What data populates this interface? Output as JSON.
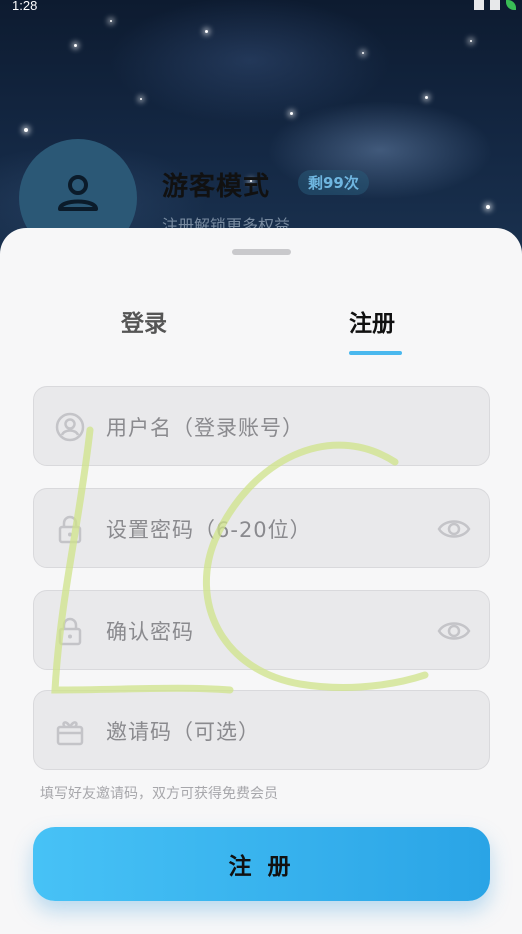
{
  "status_bar": {
    "time": "1:28"
  },
  "profile": {
    "title": "游客模式",
    "badge": "剩99次",
    "subtitle": "注册解锁更多权益"
  },
  "tabs": [
    {
      "label": "登录",
      "active": false
    },
    {
      "label": "注册",
      "active": true
    }
  ],
  "form": {
    "username_placeholder": "用户名（登录账号）",
    "password_placeholder": "设置密码（6-20位）",
    "confirm_placeholder": "确认密码",
    "invite_placeholder": "邀请码（可选）",
    "invite_hint": "填写好友邀请码，双方可获得免费会员",
    "submit_label": "注 册"
  },
  "colors": {
    "accent": "#4ab8ee",
    "button_start": "#47c2f6",
    "button_end": "#2aa4e6",
    "watermark": "#c8e07a"
  }
}
